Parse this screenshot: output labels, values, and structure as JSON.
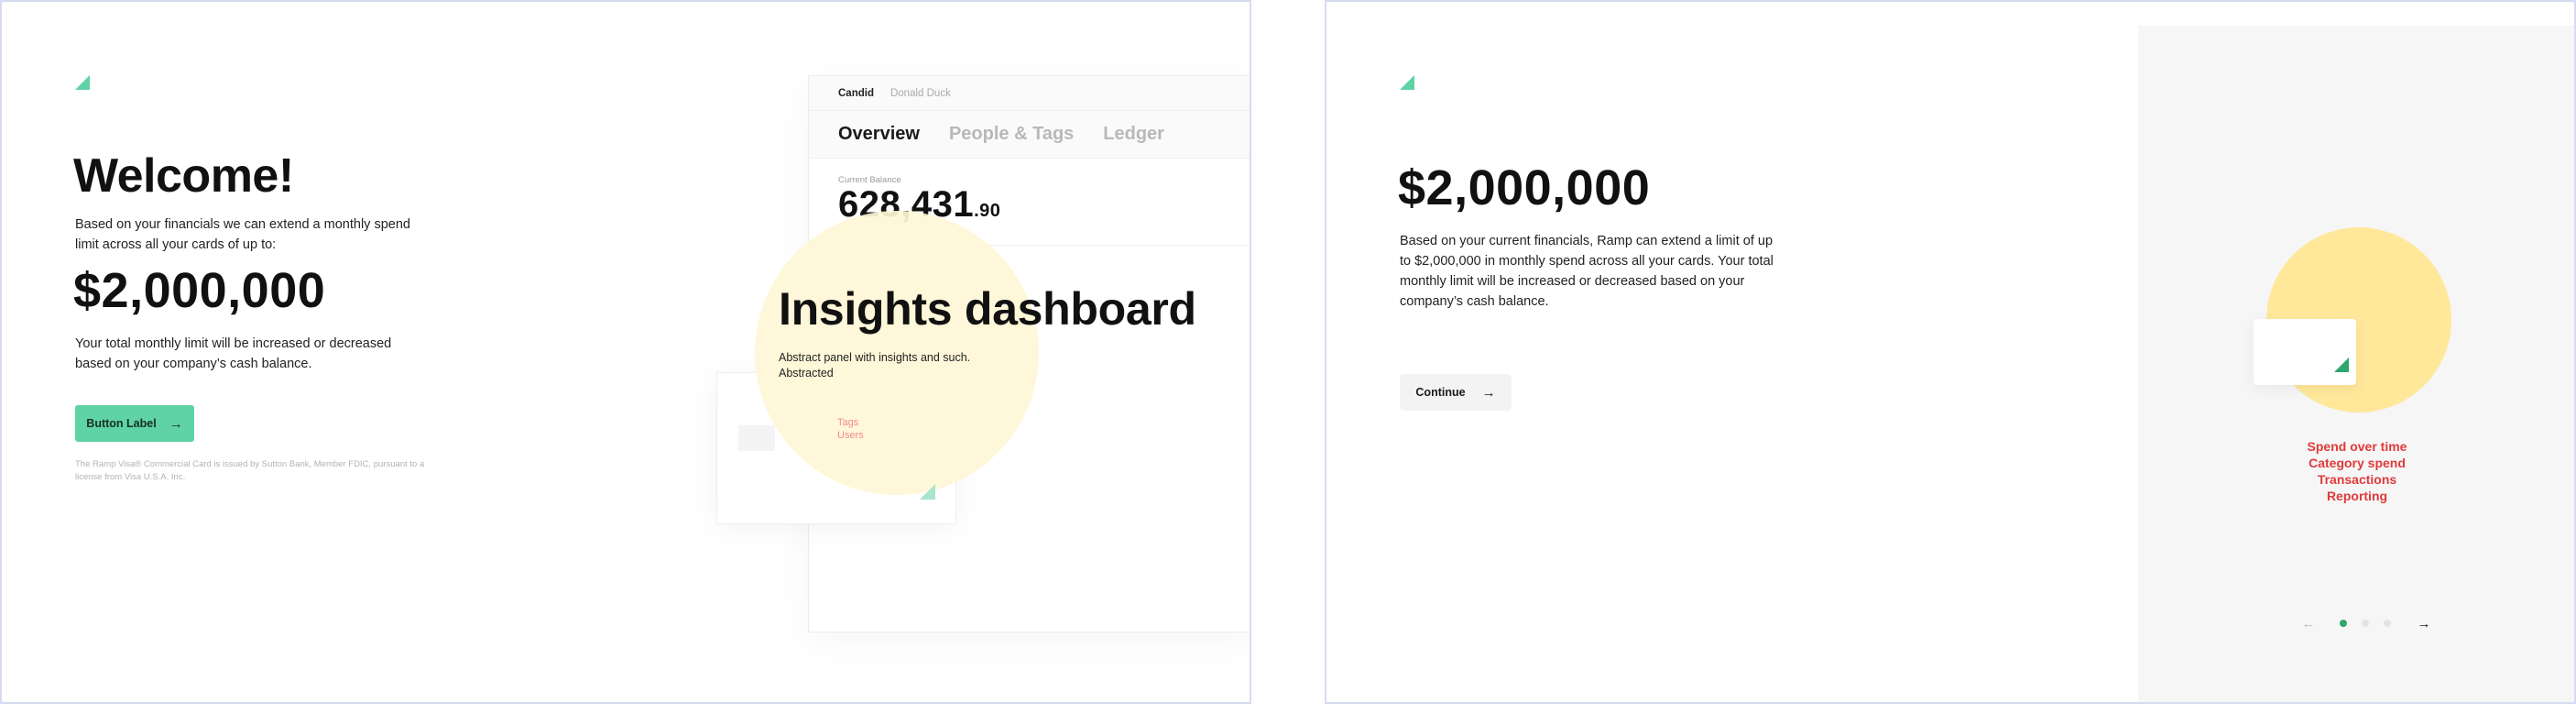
{
  "frame_a": {
    "welcome": {
      "title": "Welcome!",
      "intro": "Based on your financials we can extend a monthly spend limit across all your cards of up to:",
      "amount": "$2,000,000",
      "note": "Your total monthly limit will be increased or decreased based on your company’s cash balance.",
      "button_label": "Button Label",
      "disclaimer": "The Ramp Visa® Commercial Card is issued by Sutton Bank, Member FDIC, pursuant to a license from Visa U.S.A. Inc."
    },
    "dashboard": {
      "org": "Candid",
      "user": "Donald Duck",
      "tabs": [
        "Overview",
        "People & Tags",
        "Ledger"
      ],
      "balance_label": "Current Balance",
      "balance_main": "628,431",
      "balance_cents": ".90"
    },
    "overlay": {
      "title": "Insights dashboard",
      "subtitle_line1": "Abstract panel with insights and such.",
      "subtitle_line2": "Abstracted",
      "links": [
        "Tags",
        "Users"
      ]
    }
  },
  "frame_b": {
    "amount": "$2,000,000",
    "body": "Based on your current financials, Ramp can extend a limit of up to $2,000,000 in monthly spend across all your cards. Your total monthly limit will be increased or decreased based on your company’s cash balance.",
    "continue_label": "Continue",
    "features": [
      "Spend over time",
      "Category spend",
      "Transactions",
      "Reporting"
    ],
    "pager": {
      "pages": 3,
      "current": 1
    }
  },
  "colors": {
    "accent_green": "#5fd3a6",
    "dark_green": "#2ea66d",
    "yellow": "#ffe89a",
    "feature_red": "#e03a3a",
    "frame_border": "#d6dcef"
  },
  "icons": {
    "brand": "ramp-logo-icon",
    "arrow": "arrow-right-icon",
    "prev": "arrow-left-icon"
  }
}
